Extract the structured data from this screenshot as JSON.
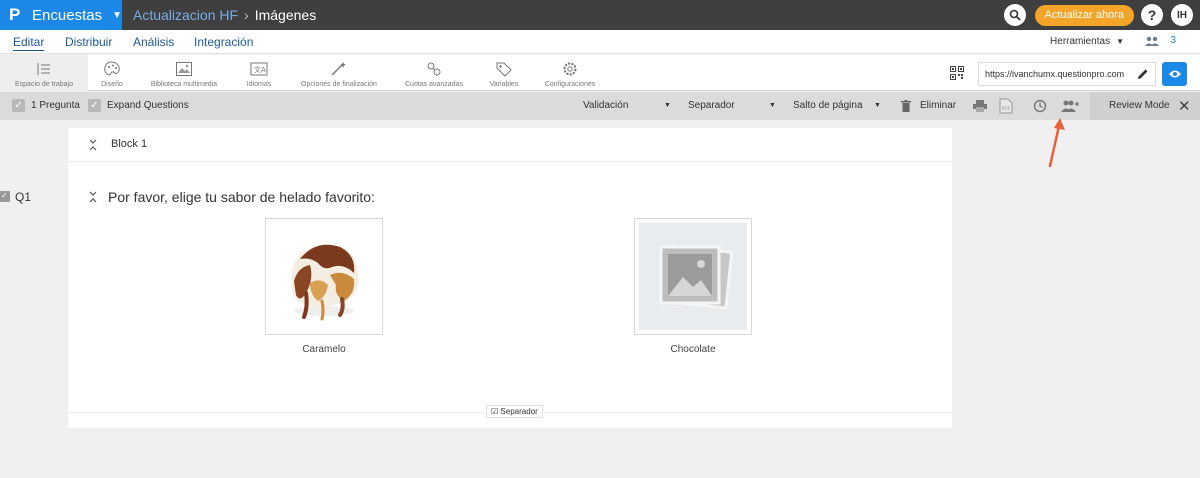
{
  "topbar": {
    "brand": "Encuestas",
    "breadcrumb_parent": "Actualizacion HF",
    "breadcrumb_child": "Imágenes",
    "upgrade_label": "Actualizar ahora",
    "help_label": "?",
    "avatar_initials": "IH"
  },
  "tabs": [
    "Editar",
    "Distribuir",
    "Análisis",
    "Integración"
  ],
  "tabs_active": "Editar",
  "tools_label": "Herramientas",
  "users_count": "3",
  "toolbar": {
    "items": [
      {
        "label": "Espacio de trabajo",
        "icon": "workspace-icon"
      },
      {
        "label": "Diseño",
        "icon": "palette-icon"
      },
      {
        "label": "Biblioteca multimedia",
        "icon": "image-icon"
      },
      {
        "label": "Idiomas",
        "icon": "translate-icon"
      },
      {
        "label": "Opciones de finalización",
        "icon": "wand-icon"
      },
      {
        "label": "Cuotas avanzadas",
        "icon": "quota-icon"
      },
      {
        "label": "Variables",
        "icon": "tag-icon"
      },
      {
        "label": "Configuraciones",
        "icon": "gear-icon"
      }
    ],
    "url": "https://ivanchumx.questionpro.com"
  },
  "actionbar": {
    "questions_label": "1 Pregunta",
    "expand_label": "Expand Questions",
    "validation_label": "Validación",
    "separator_label": "Separador",
    "pagebreak_label": "Salto de página",
    "delete_label": "Eliminar",
    "review_label": "Review Mode"
  },
  "survey": {
    "block_label": "Block 1",
    "question_number": "Q1",
    "question_text": "Por favor, elige tu sabor de helado favorito:",
    "options": [
      "Caramelo",
      "Chocolate"
    ],
    "separator_label": "Separador"
  },
  "colors": {
    "brand": "#1b87e6",
    "topbar": "#3f3f3f",
    "upgrade": "#f5a42a",
    "arrow": "#e8603c"
  }
}
